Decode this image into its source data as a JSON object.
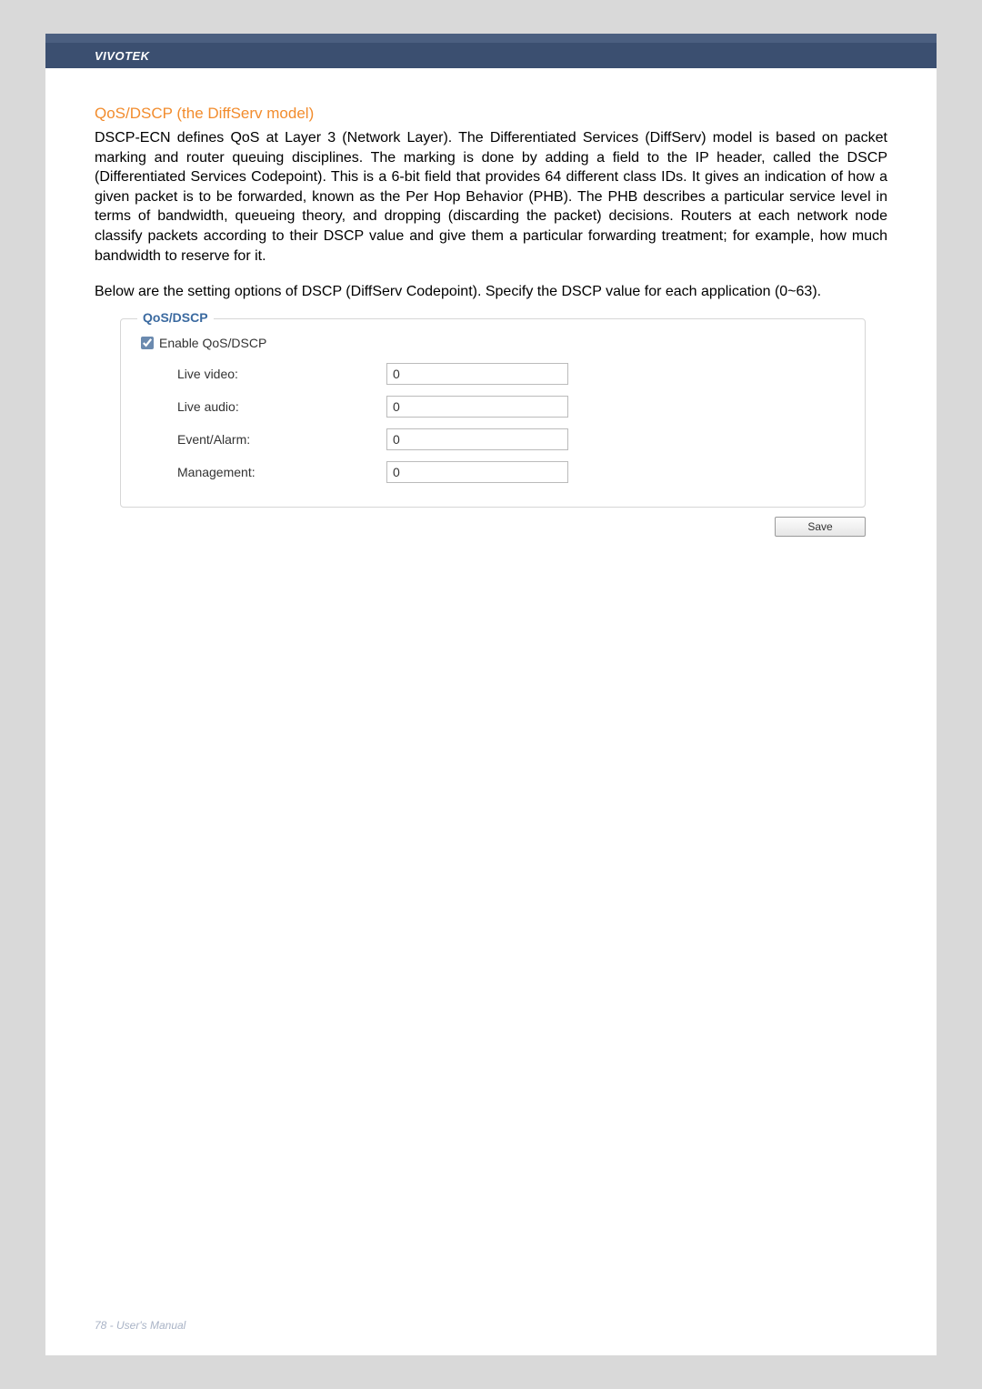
{
  "header": {
    "brand": "VIVOTEK"
  },
  "section": {
    "title": "QoS/DSCP (the DiffServ model)",
    "para1": "DSCP-ECN defines QoS at Layer 3 (Network Layer). The Differentiated Services (DiffServ) model is based on packet marking and router queuing disciplines. The marking is done by adding a field to the IP header, called the DSCP (Differentiated Services Codepoint). This is a 6-bit field that provides 64 different class IDs. It gives an indication of how a given packet is to be forwarded, known as the Per Hop Behavior (PHB). The PHB describes a particular service level in terms of bandwidth, queueing theory, and dropping (discarding the packet) decisions. Routers at each network node classify packets according to their DSCP value and give them a particular forwarding treatment; for example, how much bandwidth to reserve for it.",
    "para2": "Below are the setting options of DSCP (DiffServ Codepoint). Specify the DSCP value for each application (0~63)."
  },
  "form": {
    "legend": "QoS/DSCP",
    "enable_label": "Enable QoS/DSCP",
    "enable_checked": true,
    "rows": {
      "live_video": {
        "label": "Live video:",
        "value": "0"
      },
      "live_audio": {
        "label": "Live audio:",
        "value": "0"
      },
      "event_alarm": {
        "label": "Event/Alarm:",
        "value": "0"
      },
      "management": {
        "label": "Management:",
        "value": "0"
      }
    },
    "save_label": "Save"
  },
  "footer": {
    "text": "78 - User's Manual"
  }
}
